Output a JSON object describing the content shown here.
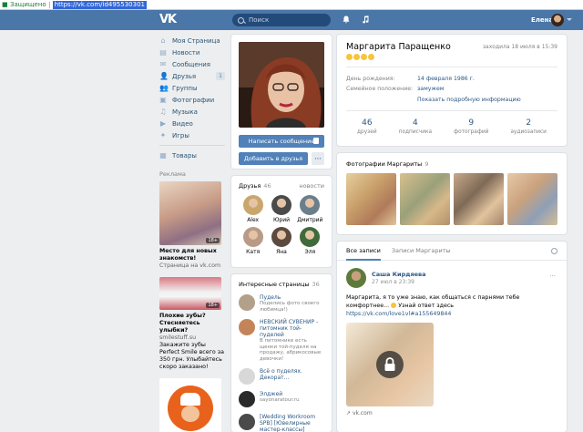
{
  "browser": {
    "secure_label": "Защищено",
    "url": "https://vk.com/id495530301"
  },
  "header": {
    "search_placeholder": "Поиск",
    "user_name": "Елена"
  },
  "sidebar": {
    "items": [
      {
        "label": "Моя Страница",
        "icon": "home-icon",
        "glyph": "⌂"
      },
      {
        "label": "Новости",
        "icon": "news-icon",
        "glyph": "▤"
      },
      {
        "label": "Сообщения",
        "icon": "messages-icon",
        "glyph": "✉"
      },
      {
        "label": "Друзья",
        "icon": "friends-icon",
        "glyph": "👤",
        "count": "1"
      },
      {
        "label": "Группы",
        "icon": "groups-icon",
        "glyph": "👥"
      },
      {
        "label": "Фотографии",
        "icon": "photos-icon",
        "glyph": "▣"
      },
      {
        "label": "Музыка",
        "icon": "music-icon",
        "glyph": "♫"
      },
      {
        "label": "Видео",
        "icon": "video-icon",
        "glyph": "▶"
      },
      {
        "label": "Игры",
        "icon": "games-icon",
        "glyph": "✦"
      },
      {
        "label": "Товары",
        "icon": "goods-icon",
        "glyph": "▦"
      }
    ],
    "ads_title": "Реклама",
    "ads": [
      {
        "badge": "18+",
        "title": "Место для новых знакомств!",
        "domain": "Страница на vk.com",
        "text": ""
      },
      {
        "badge": "18+",
        "title": "Плохие зубы? Стесняетесь улыбки?",
        "domain": "smilestuff.su",
        "text": "Закажите зубы Perfect Smile всего за 350 грн. Улыбайтесь скоро заказано!"
      },
      {
        "badge": "",
        "title": "",
        "domain": "",
        "text": ""
      }
    ]
  },
  "profile": {
    "write_button": "Написать сообщение",
    "add_friend_button": "Добавить в друзья",
    "more_button": "···"
  },
  "friends": {
    "title": "Друзья",
    "count": "46",
    "more": "новости",
    "items": [
      {
        "name": "Alex",
        "color": "#c9a66b"
      },
      {
        "name": "Юрий",
        "color": "#4a4a4a"
      },
      {
        "name": "Дмитрий",
        "color": "#6b7f8a"
      },
      {
        "name": "Катя",
        "color": "#b89a86"
      },
      {
        "name": "Яна",
        "color": "#5d4a3f"
      },
      {
        "name": "Эля",
        "color": "#3f6b3a"
      }
    ]
  },
  "pages": {
    "title": "Интересные страницы",
    "count": "36",
    "items": [
      {
        "name": "Пудель",
        "desc": "Поделись фото своего любимца!)",
        "color": "#b3a08a"
      },
      {
        "name": "НЕВСКИЙ СУВЕНИР - питомник той-пуделей",
        "desc": "В питомнике есть щенки той-пуделя на продажу, абрикосовые девочки!",
        "color": "#c4845a"
      },
      {
        "name": "Всё о пуделях. Декорат...",
        "desc": "",
        "color": "#d8d8d8"
      },
      {
        "name": "Элджей",
        "desc": "sayonaratour.ru",
        "color": "#2a2a2a"
      },
      {
        "name": "[Wedding Workroom SPB] [Ювелирные мастер-классы]",
        "desc": "",
        "color": "#4a4a4a"
      }
    ]
  },
  "info": {
    "name": "Маргарита Паращенко",
    "last_seen": "заходила 18 июля в 15:39",
    "rows": [
      {
        "label": "День рождения:",
        "value": "14 февраля 1986 г."
      },
      {
        "label": "Семейное положение:",
        "value": "замужем"
      }
    ],
    "more_info": "Показать подробную информацию",
    "stats": [
      {
        "num": "46",
        "label": "друзей"
      },
      {
        "num": "4",
        "label": "подписчика"
      },
      {
        "num": "9",
        "label": "фотографий"
      },
      {
        "num": "2",
        "label": "аудиозаписи"
      }
    ]
  },
  "photos": {
    "title": "Фотографии Маргариты",
    "count": "9"
  },
  "wall": {
    "tabs": [
      "Все записи",
      "Записи Маргариты"
    ],
    "post": {
      "author": "Саша Кирдяева",
      "date": "27 июл в 23:39",
      "text": "Маргарита, я то уже знаю, как общаться с парнями тебе комфортнее...",
      "text2": "Узнай ответ здесь",
      "link": "https://vk.com/love1vl#a155649844",
      "source": "vk.com",
      "more": "···"
    }
  },
  "colors": {
    "header": "#4a76a8",
    "link": "#2a5885",
    "button": "#5181b8"
  }
}
